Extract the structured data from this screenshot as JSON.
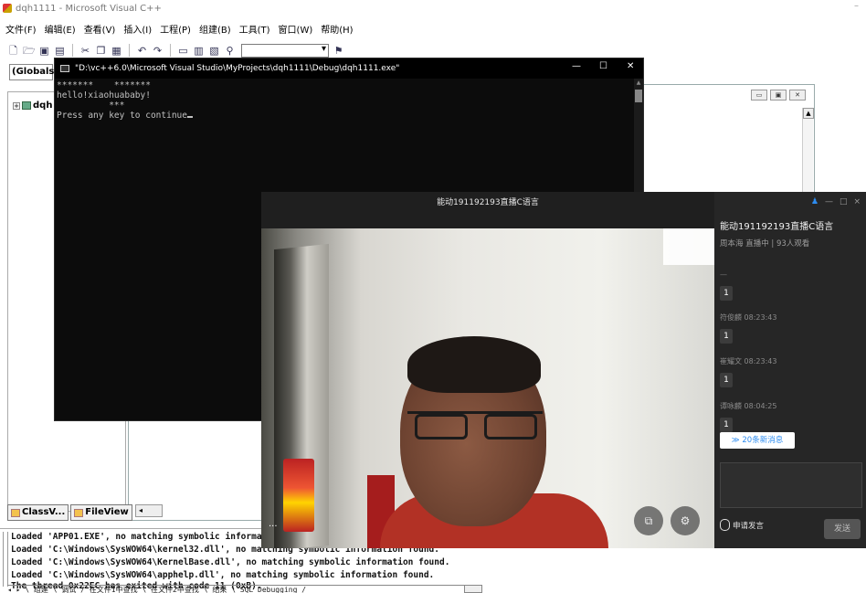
{
  "vc": {
    "title": "dqh1111 - Microsoft Visual C++",
    "minimize": "–",
    "menu": [
      "文件(F)",
      "编辑(E)",
      "查看(V)",
      "插入(I)",
      "工程(P)",
      "组建(B)",
      "工具(T)",
      "窗口(W)",
      "帮助(H)"
    ],
    "globals_combo": "(Globals)",
    "tree_root": "dqh",
    "workspace_tabs": [
      "ClassV...",
      "FileView"
    ]
  },
  "console": {
    "title": "\"D:\\vc++6.0\\Microsoft Visual Studio\\MyProjects\\dqh1111\\Debug\\dqh1111.exe\"",
    "lines": [
      "*******    *******",
      "hello!xiaohuababy!",
      "          ***",
      "Press any key to continue"
    ],
    "controls": {
      "min": "—",
      "max": "☐",
      "close": "✕"
    }
  },
  "output": {
    "lines": [
      "Loaded 'APP01.EXE', no matching symbolic information found.",
      "Loaded 'C:\\Windows\\SysWOW64\\kernel32.dll', no matching symbolic information found.",
      "Loaded 'C:\\Windows\\SysWOW64\\KernelBase.dll', no matching symbolic information found.",
      "Loaded 'C:\\Windows\\SysWOW64\\apphelp.dll', no matching symbolic information found.",
      "The thread 0x22EC has exited with code 11 (0xB)."
    ],
    "tabs_text": "◂ ▸ \\ 组建 \\ 调试 / 在文件1中查找 \\ 在文件2中查找 \\ 结果 \\ SQL Debugging /"
  },
  "live": {
    "video_title": "能动191192193直播C语言",
    "dots": "...",
    "side_title": "能动191192193直播C语言",
    "side_sub": "周本海 直播中 | 93人观看",
    "chat_dash": "—",
    "chat": [
      {
        "name": "",
        "message": "1"
      },
      {
        "name": "符俊麟 08:23:43",
        "message": "1"
      },
      {
        "name": "崔耀文 08:23:43",
        "message": "1"
      },
      {
        "name": "谭咏麟 08:04:25",
        "message": "1"
      }
    ],
    "new_messages": "≫ 20条新消息",
    "apply_speak": "申请发言",
    "send": "发送",
    "window_controls": {
      "user": "♟",
      "min": "—",
      "max": "□",
      "close": "×"
    }
  }
}
